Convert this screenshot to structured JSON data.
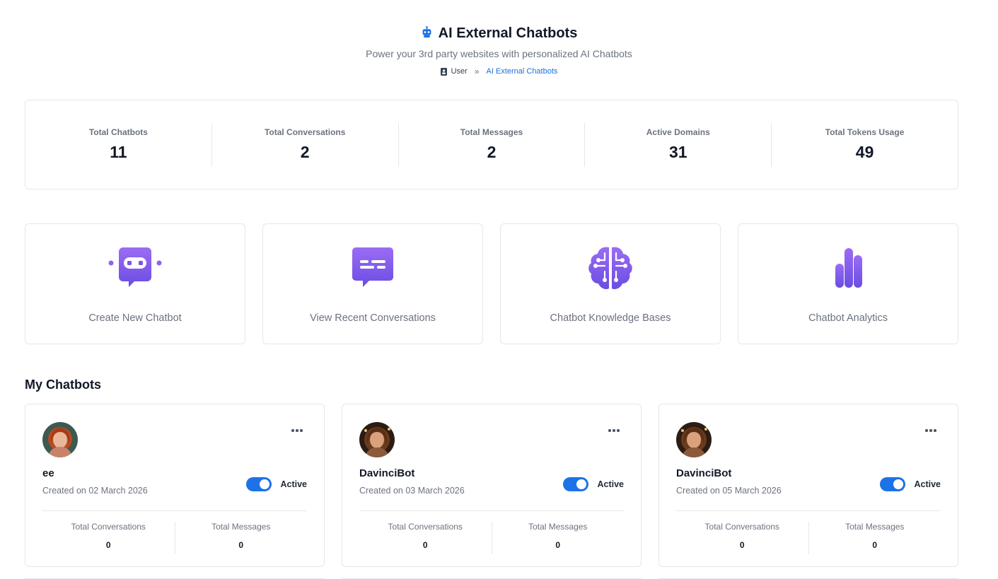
{
  "header": {
    "title": "AI External Chatbots",
    "title_icon": "robot-icon",
    "subtitle": "Power your 3rd party websites with personalized AI Chatbots",
    "breadcrumb": {
      "user": "User",
      "separator": "»",
      "current": "AI External Chatbots"
    }
  },
  "stats": [
    {
      "label": "Total Chatbots",
      "value": "11"
    },
    {
      "label": "Total Conversations",
      "value": "2"
    },
    {
      "label": "Total Messages",
      "value": "2"
    },
    {
      "label": "Active Domains",
      "value": "31"
    },
    {
      "label": "Total Tokens Usage",
      "value": "49"
    }
  ],
  "actions": [
    {
      "label": "Create New Chatbot",
      "icon": "chatbot-icon"
    },
    {
      "label": "View Recent Conversations",
      "icon": "chat-bubble-icon"
    },
    {
      "label": "Chatbot Knowledge Bases",
      "icon": "brain-icon"
    },
    {
      "label": "Chatbot Analytics",
      "icon": "bar-chart-icon"
    }
  ],
  "my_chatbots": {
    "title": "My Chatbots",
    "items": [
      {
        "name": "ee",
        "created": "Created on 02 March 2026",
        "status": "Active",
        "conversations_label": "Total Conversations",
        "conversations": "0",
        "messages_label": "Total Messages",
        "messages": "0"
      },
      {
        "name": "DavinciBot",
        "created": "Created on 03 March 2026",
        "status": "Active",
        "conversations_label": "Total Conversations",
        "conversations": "0",
        "messages_label": "Total Messages",
        "messages": "0"
      },
      {
        "name": "DavinciBot",
        "created": "Created on 05 March 2026",
        "status": "Active",
        "conversations_label": "Total Conversations",
        "conversations": "0",
        "messages_label": "Total Messages",
        "messages": "0"
      }
    ]
  },
  "colors": {
    "accent": "#1d72e8",
    "icon_gradient_start": "#8b5cf6",
    "icon_gradient_end": "#6d4de6"
  }
}
